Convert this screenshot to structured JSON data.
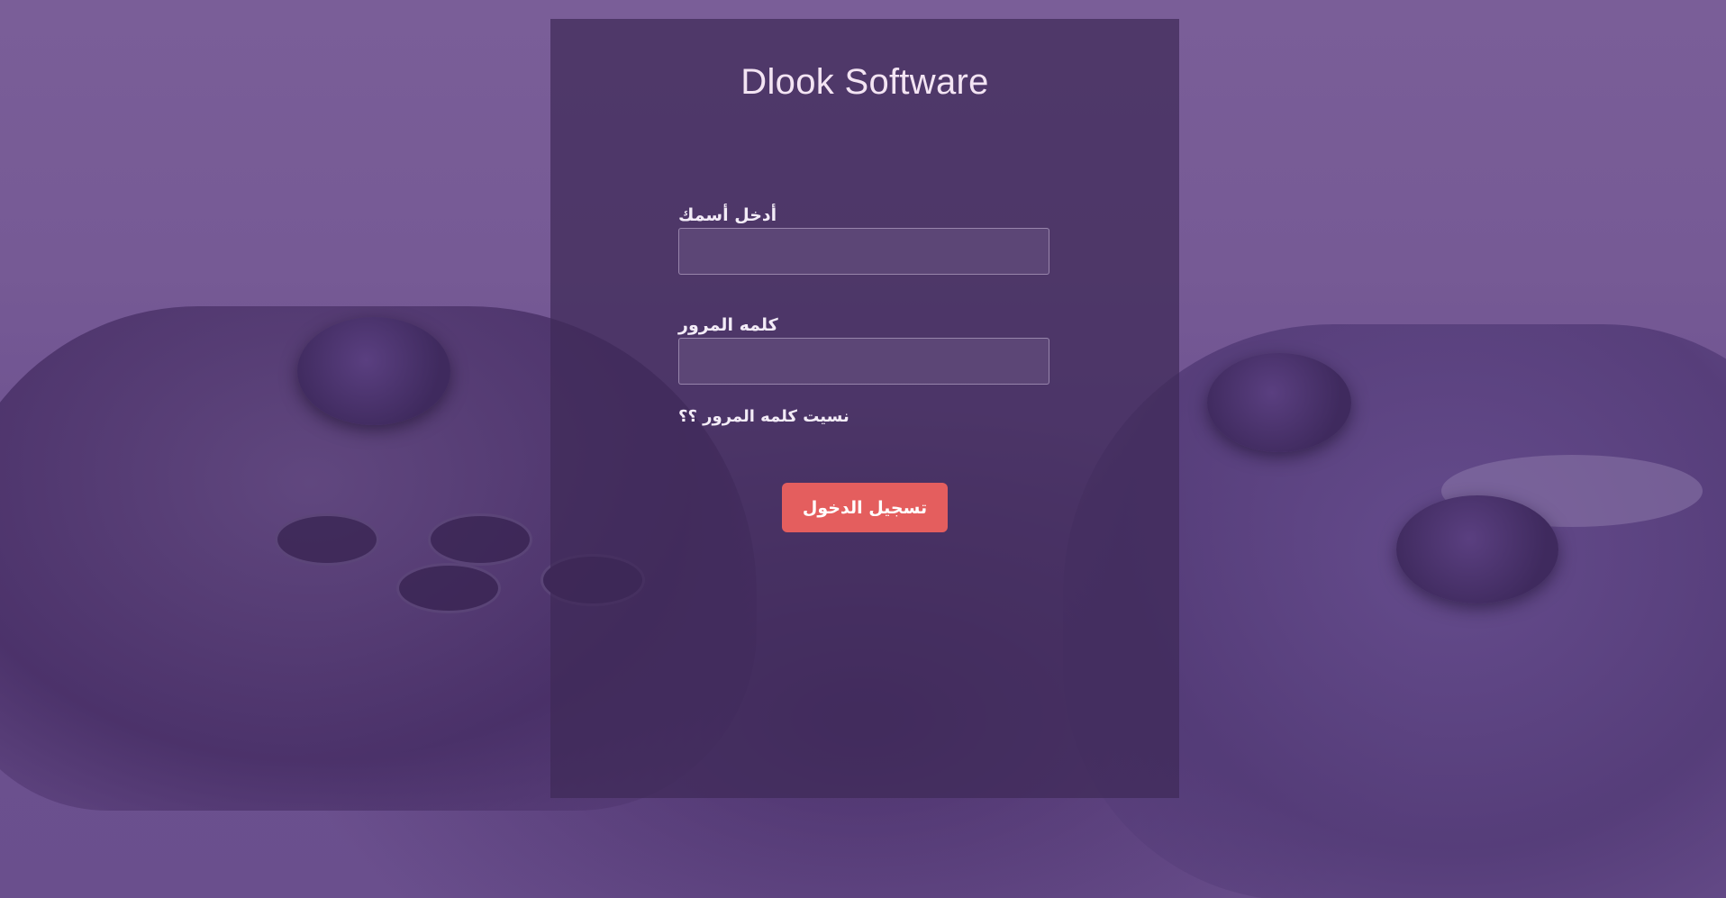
{
  "app": {
    "title": "Dlook Software"
  },
  "form": {
    "username_label": "أدخل أسمك",
    "username_value": "",
    "password_label": "كلمه المرور",
    "password_value": "",
    "forgot_link": "نسيت كلمه المرور ؟؟",
    "submit_label": "تسجيل الدخول"
  },
  "colors": {
    "background": "#7a5e98",
    "card": "#3e2a58",
    "button": "#e45e5e",
    "text": "#f3ecf7"
  },
  "background_image": {
    "subject": "game-controllers-photo"
  }
}
